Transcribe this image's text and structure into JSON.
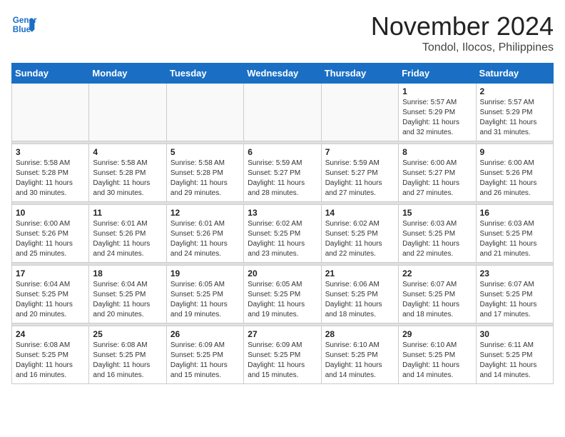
{
  "header": {
    "logo_line1": "General",
    "logo_line2": "Blue",
    "title": "November 2024",
    "subtitle": "Tondol, Ilocos, Philippines"
  },
  "weekdays": [
    "Sunday",
    "Monday",
    "Tuesday",
    "Wednesday",
    "Thursday",
    "Friday",
    "Saturday"
  ],
  "weeks": [
    [
      {
        "day": "",
        "info": ""
      },
      {
        "day": "",
        "info": ""
      },
      {
        "day": "",
        "info": ""
      },
      {
        "day": "",
        "info": ""
      },
      {
        "day": "",
        "info": ""
      },
      {
        "day": "1",
        "info": "Sunrise: 5:57 AM\nSunset: 5:29 PM\nDaylight: 11 hours\nand 32 minutes."
      },
      {
        "day": "2",
        "info": "Sunrise: 5:57 AM\nSunset: 5:29 PM\nDaylight: 11 hours\nand 31 minutes."
      }
    ],
    [
      {
        "day": "3",
        "info": "Sunrise: 5:58 AM\nSunset: 5:28 PM\nDaylight: 11 hours\nand 30 minutes."
      },
      {
        "day": "4",
        "info": "Sunrise: 5:58 AM\nSunset: 5:28 PM\nDaylight: 11 hours\nand 30 minutes."
      },
      {
        "day": "5",
        "info": "Sunrise: 5:58 AM\nSunset: 5:28 PM\nDaylight: 11 hours\nand 29 minutes."
      },
      {
        "day": "6",
        "info": "Sunrise: 5:59 AM\nSunset: 5:27 PM\nDaylight: 11 hours\nand 28 minutes."
      },
      {
        "day": "7",
        "info": "Sunrise: 5:59 AM\nSunset: 5:27 PM\nDaylight: 11 hours\nand 27 minutes."
      },
      {
        "day": "8",
        "info": "Sunrise: 6:00 AM\nSunset: 5:27 PM\nDaylight: 11 hours\nand 27 minutes."
      },
      {
        "day": "9",
        "info": "Sunrise: 6:00 AM\nSunset: 5:26 PM\nDaylight: 11 hours\nand 26 minutes."
      }
    ],
    [
      {
        "day": "10",
        "info": "Sunrise: 6:00 AM\nSunset: 5:26 PM\nDaylight: 11 hours\nand 25 minutes."
      },
      {
        "day": "11",
        "info": "Sunrise: 6:01 AM\nSunset: 5:26 PM\nDaylight: 11 hours\nand 24 minutes."
      },
      {
        "day": "12",
        "info": "Sunrise: 6:01 AM\nSunset: 5:26 PM\nDaylight: 11 hours\nand 24 minutes."
      },
      {
        "day": "13",
        "info": "Sunrise: 6:02 AM\nSunset: 5:25 PM\nDaylight: 11 hours\nand 23 minutes."
      },
      {
        "day": "14",
        "info": "Sunrise: 6:02 AM\nSunset: 5:25 PM\nDaylight: 11 hours\nand 22 minutes."
      },
      {
        "day": "15",
        "info": "Sunrise: 6:03 AM\nSunset: 5:25 PM\nDaylight: 11 hours\nand 22 minutes."
      },
      {
        "day": "16",
        "info": "Sunrise: 6:03 AM\nSunset: 5:25 PM\nDaylight: 11 hours\nand 21 minutes."
      }
    ],
    [
      {
        "day": "17",
        "info": "Sunrise: 6:04 AM\nSunset: 5:25 PM\nDaylight: 11 hours\nand 20 minutes."
      },
      {
        "day": "18",
        "info": "Sunrise: 6:04 AM\nSunset: 5:25 PM\nDaylight: 11 hours\nand 20 minutes."
      },
      {
        "day": "19",
        "info": "Sunrise: 6:05 AM\nSunset: 5:25 PM\nDaylight: 11 hours\nand 19 minutes."
      },
      {
        "day": "20",
        "info": "Sunrise: 6:05 AM\nSunset: 5:25 PM\nDaylight: 11 hours\nand 19 minutes."
      },
      {
        "day": "21",
        "info": "Sunrise: 6:06 AM\nSunset: 5:25 PM\nDaylight: 11 hours\nand 18 minutes."
      },
      {
        "day": "22",
        "info": "Sunrise: 6:07 AM\nSunset: 5:25 PM\nDaylight: 11 hours\nand 18 minutes."
      },
      {
        "day": "23",
        "info": "Sunrise: 6:07 AM\nSunset: 5:25 PM\nDaylight: 11 hours\nand 17 minutes."
      }
    ],
    [
      {
        "day": "24",
        "info": "Sunrise: 6:08 AM\nSunset: 5:25 PM\nDaylight: 11 hours\nand 16 minutes."
      },
      {
        "day": "25",
        "info": "Sunrise: 6:08 AM\nSunset: 5:25 PM\nDaylight: 11 hours\nand 16 minutes."
      },
      {
        "day": "26",
        "info": "Sunrise: 6:09 AM\nSunset: 5:25 PM\nDaylight: 11 hours\nand 15 minutes."
      },
      {
        "day": "27",
        "info": "Sunrise: 6:09 AM\nSunset: 5:25 PM\nDaylight: 11 hours\nand 15 minutes."
      },
      {
        "day": "28",
        "info": "Sunrise: 6:10 AM\nSunset: 5:25 PM\nDaylight: 11 hours\nand 14 minutes."
      },
      {
        "day": "29",
        "info": "Sunrise: 6:10 AM\nSunset: 5:25 PM\nDaylight: 11 hours\nand 14 minutes."
      },
      {
        "day": "30",
        "info": "Sunrise: 6:11 AM\nSunset: 5:25 PM\nDaylight: 11 hours\nand 14 minutes."
      }
    ]
  ]
}
